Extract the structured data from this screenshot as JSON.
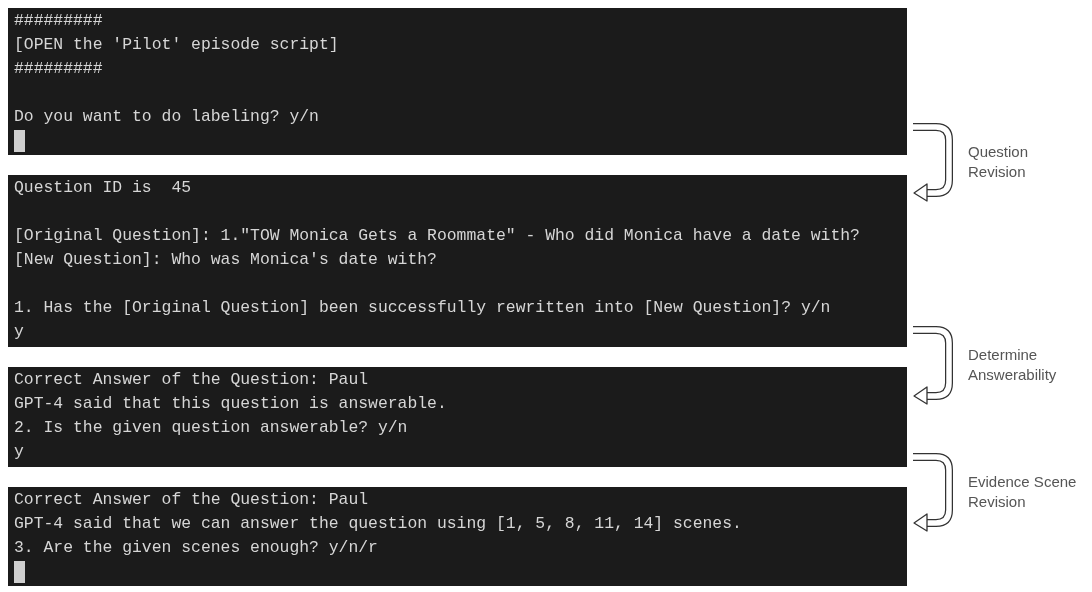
{
  "panels": [
    {
      "blocks": [
        [
          "#########",
          "[OPEN the 'Pilot' episode script]",
          "#########"
        ],
        [
          "Do you want to do labeling? y/n"
        ]
      ],
      "cursor": true
    },
    {
      "blocks": [
        [
          "Question ID is  45"
        ],
        [
          "[Original Question]: 1.\"TOW Monica Gets a Roommate\" - Who did Monica have a date with?",
          "[New Question]: Who was Monica's date with?"
        ],
        [
          "1. Has the [Original Question] been successfully rewritten into [New Question]? y/n",
          "y"
        ]
      ],
      "cursor": false
    },
    {
      "blocks": [
        [
          "Correct Answer of the Question: Paul",
          "GPT-4 said that this question is answerable.",
          "2. Is the given question answerable? y/n",
          "y"
        ]
      ],
      "cursor": false
    },
    {
      "blocks": [
        [
          "Correct Answer of the Question: Paul",
          "GPT-4 said that we can answer the question using [1, 5, 8, 11, 14] scenes.",
          "3. Are the given scenes enough? y/n/r"
        ]
      ],
      "cursor": true
    }
  ],
  "steps": [
    {
      "label": [
        "Question",
        "Revision"
      ]
    },
    {
      "label": [
        "Determine",
        "Answerability"
      ]
    },
    {
      "label": [
        "Evidence Scene",
        "Revision"
      ]
    }
  ]
}
